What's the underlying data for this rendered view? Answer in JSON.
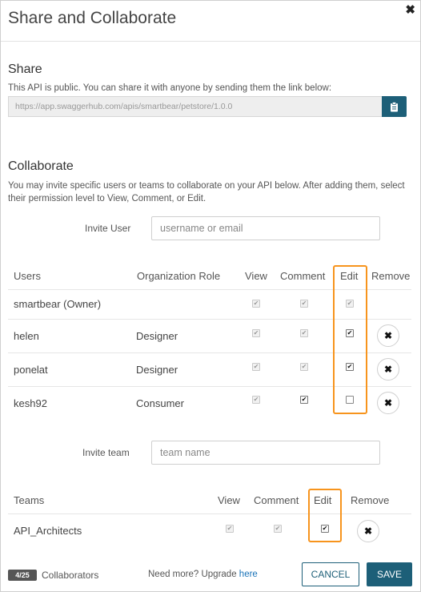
{
  "dialog": {
    "title": "Share and Collaborate",
    "close_glyph": "✖"
  },
  "share": {
    "heading": "Share",
    "description": "This API is public. You can share it with anyone by sending them the link below:",
    "link": "https://app.swaggerhub.com/apis/smartbear/petstore/1.0.0",
    "copy_icon": "clipboard-icon"
  },
  "collaborate": {
    "heading": "Collaborate",
    "description_line1": "You may invite specific users or teams to collaborate on your API below. After adding them, select",
    "description_line2": "their permission level to View, Comment, or Edit.",
    "invite_user_label": "Invite User",
    "invite_user_placeholder": "username or email",
    "invite_team_label": "Invite team",
    "invite_team_placeholder": "team name"
  },
  "users_table": {
    "headers": {
      "users": "Users",
      "role": "Organization Role",
      "view": "View",
      "comment": "Comment",
      "edit": "Edit",
      "remove": "Remove"
    },
    "rows": [
      {
        "name": "smartbear (Owner)",
        "role": "",
        "view": true,
        "comment": true,
        "edit": true,
        "locked": true,
        "removable": false
      },
      {
        "name": "helen",
        "role": "Designer",
        "view": true,
        "comment": true,
        "edit": true,
        "locked": false,
        "removable": true
      },
      {
        "name": "ponelat",
        "role": "Designer",
        "view": true,
        "comment": true,
        "edit": true,
        "locked": false,
        "removable": true
      },
      {
        "name": "kesh92",
        "role": "Consumer",
        "view": true,
        "comment": true,
        "edit": false,
        "locked": false,
        "removable": true
      }
    ]
  },
  "teams_table": {
    "headers": {
      "teams": "Teams",
      "view": "View",
      "comment": "Comment",
      "edit": "Edit",
      "remove": "Remove"
    },
    "rows": [
      {
        "name": "API_Architects",
        "view": true,
        "comment": true,
        "edit": true,
        "removable": true
      }
    ]
  },
  "footer": {
    "badge": "4/25",
    "collaborators_label": "Collaborators",
    "need_more": "Need more? Upgrade",
    "upgrade_link": "here",
    "cancel_label": "CANCEL",
    "save_label": "SAVE"
  },
  "colors": {
    "primary": "#1d5f78",
    "highlight": "#f7941d"
  },
  "remove_glyph": "✖",
  "check_glyph": "✔"
}
